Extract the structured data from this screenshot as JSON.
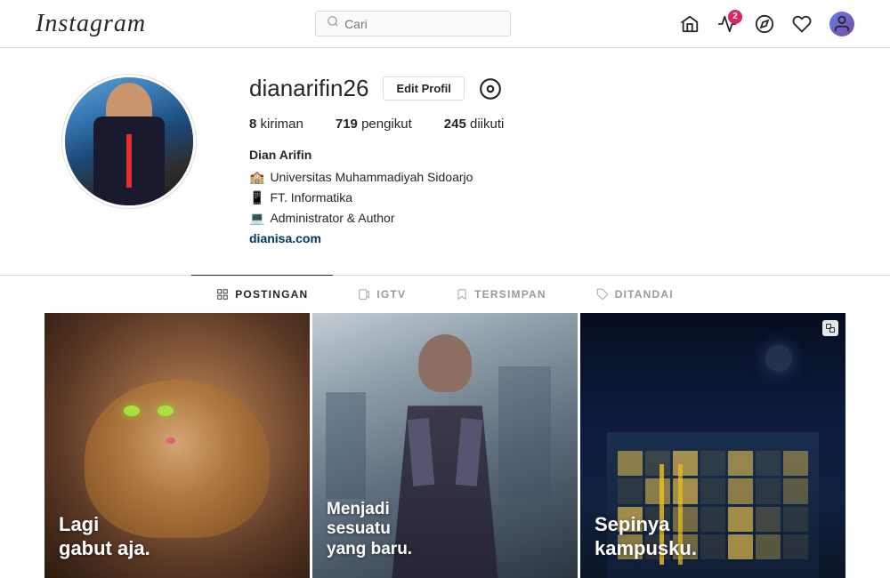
{
  "app": {
    "name": "Instagram"
  },
  "navbar": {
    "search_placeholder": "Cari",
    "notification_count": "2"
  },
  "profile": {
    "username": "dianarifin26",
    "edit_button": "Edit Profil",
    "stats": {
      "posts_count": "8",
      "posts_label": "kiriman",
      "followers_count": "719",
      "followers_label": "pengikut",
      "following_count": "245",
      "following_label": "diikuti"
    },
    "bio": {
      "name": "Dian Arifin",
      "university": "Universitas Muhammadiyah Sidoarjo",
      "faculty": "FT. Informatika",
      "role": "Administrator & Author",
      "website": "dianisa.com"
    }
  },
  "tabs": [
    {
      "id": "postingan",
      "label": "POSTINGAN",
      "active": true
    },
    {
      "id": "igtv",
      "label": "IGTV",
      "active": false
    },
    {
      "id": "tersimpan",
      "label": "TERSIMPAN",
      "active": false
    },
    {
      "id": "ditandai",
      "label": "DITANDAI",
      "active": false
    }
  ],
  "posts": [
    {
      "id": 1,
      "text": "Lagi\ngabut aja.",
      "has_multi": false
    },
    {
      "id": 2,
      "text": "Menjadi\nsesuatu\nyang baru.",
      "has_multi": false
    },
    {
      "id": 3,
      "text": "Sepinya\nkampusku.",
      "has_multi": true
    }
  ]
}
